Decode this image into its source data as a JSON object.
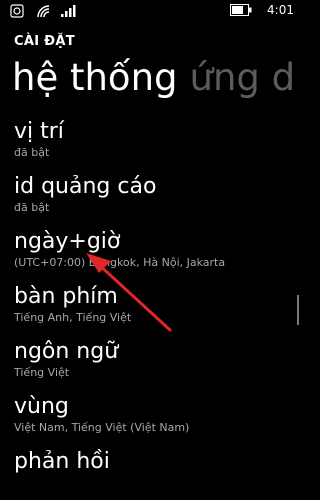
{
  "status": {
    "time": "4:01",
    "icons": [
      "notification-icon",
      "wifi-icon",
      "cellular-signal-icon",
      "battery-icon"
    ]
  },
  "header": {
    "section": "CÀI ĐẶT"
  },
  "pivot": {
    "items": [
      "hệ thống",
      "ứng d"
    ]
  },
  "settings": {
    "items": [
      {
        "title": "vị trí",
        "subtitle": "đã bật"
      },
      {
        "title": "id quảng cáo",
        "subtitle": "đã bật"
      },
      {
        "title": "ngày+giờ",
        "subtitle": "(UTC+07:00) Bangkok, Hà Nội, Jakarta"
      },
      {
        "title": "bàn phím",
        "subtitle": "Tiếng Anh, Tiếng Việt"
      },
      {
        "title": "ngôn ngữ",
        "subtitle": "Tiếng Việt"
      },
      {
        "title": "vùng",
        "subtitle": "Việt Nam, Tiếng Việt (Việt Nam)"
      },
      {
        "title": "phản hồi",
        "subtitle": ""
      }
    ]
  },
  "colors": {
    "background": "#000000",
    "text": "#ffffff",
    "subtext": "#a7a7a7",
    "pivot_inactive": "#5c5c5c",
    "annotation_arrow": "#e1262b"
  }
}
